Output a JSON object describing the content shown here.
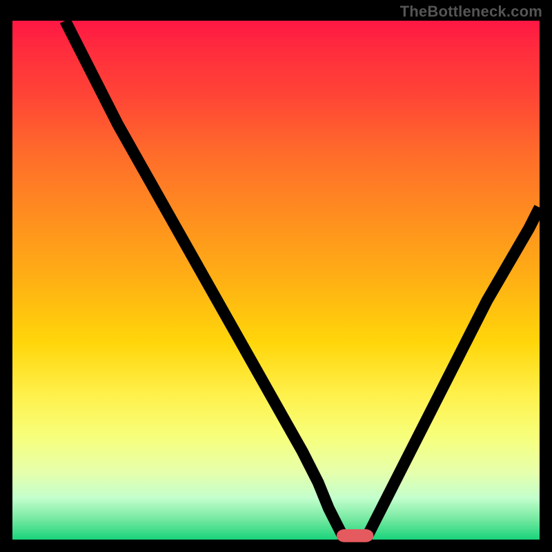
{
  "watermark": "TheBottleneck.com",
  "chart_data": {
    "type": "line",
    "title": "",
    "xlabel": "",
    "ylabel": "",
    "xlim": [
      0,
      100
    ],
    "ylim": [
      0,
      100
    ],
    "background_gradient": {
      "orientation": "vertical",
      "stops": [
        {
          "pos": 0,
          "color": "#ff1744"
        },
        {
          "pos": 50,
          "color": "#ffc107"
        },
        {
          "pos": 80,
          "color": "#fff176"
        },
        {
          "pos": 100,
          "color": "#19d37b"
        }
      ]
    },
    "series": [
      {
        "name": "curve-left",
        "x": [
          10,
          15,
          20,
          25,
          30,
          35,
          40,
          45,
          50,
          55,
          58,
          60,
          62,
          63
        ],
        "y": [
          100,
          90,
          80,
          71,
          62,
          53,
          44,
          35,
          26,
          17,
          11,
          6,
          2,
          0
        ]
      },
      {
        "name": "curve-right",
        "x": [
          67,
          70,
          74,
          78,
          82,
          86,
          90,
          94,
          98,
          100
        ],
        "y": [
          0,
          6,
          14,
          22,
          30,
          38,
          46,
          53,
          60,
          64
        ]
      }
    ],
    "marker": {
      "x_center": 65,
      "y": 0,
      "width": 6,
      "height": 1.5,
      "color": "#e55a5f",
      "shape": "rounded-rect"
    }
  }
}
